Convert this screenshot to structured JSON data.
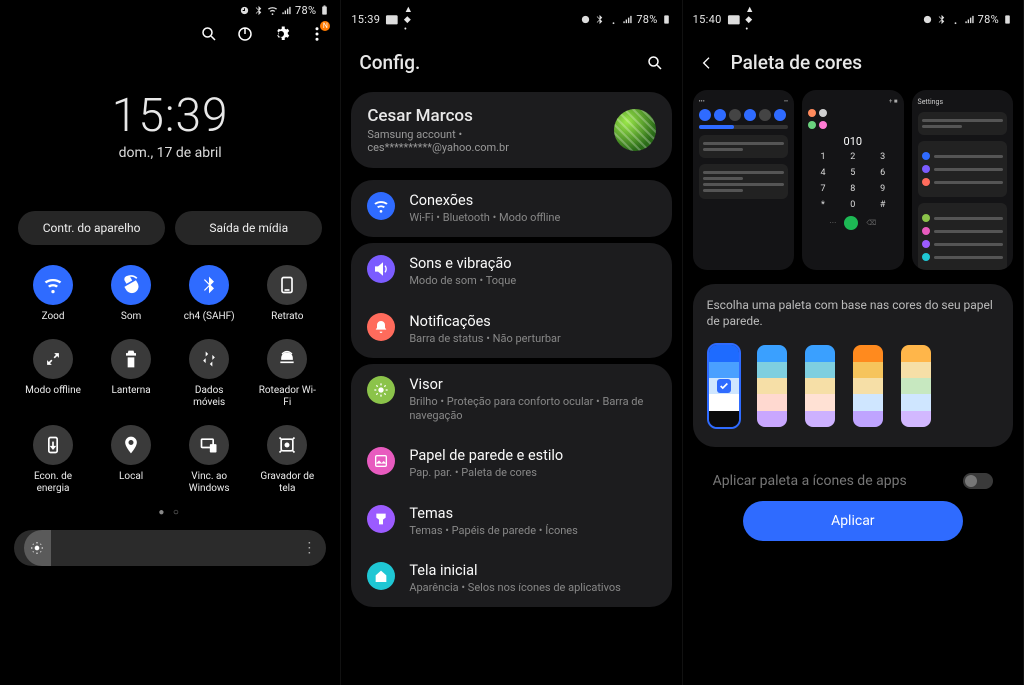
{
  "status": {
    "time_a": "15:39",
    "time_b": "15:39",
    "time_c": "15:40",
    "battery": "78%"
  },
  "qs": {
    "time": "15:39",
    "date": "dom., 17 de abril",
    "device_controls": "Contr. do aparelho",
    "media_output": "Saída de mídia",
    "tiles": [
      {
        "label": "Zood",
        "on": true
      },
      {
        "label": "Som",
        "on": true
      },
      {
        "label": "ch4 (SAHF)",
        "on": true
      },
      {
        "label": "Retrato",
        "on": false
      },
      {
        "label": "Modo offline",
        "on": false
      },
      {
        "label": "Lanterna",
        "on": false
      },
      {
        "label": "Dados móveis",
        "on": false
      },
      {
        "label": "Roteador Wi-Fi",
        "on": false
      },
      {
        "label": "Econ. de energia",
        "on": false
      },
      {
        "label": "Local",
        "on": false
      },
      {
        "label": "Vinc. ao Windows",
        "on": false
      },
      {
        "label": "Gravador de tela",
        "on": false
      }
    ],
    "page_dots": "● ○",
    "badge": "N"
  },
  "settings": {
    "title": "Config.",
    "account": {
      "name": "Cesar Marcos",
      "sub": "Samsung account  •  ces**********@yahoo.com.br"
    },
    "groups": [
      [
        {
          "color": "#2f6bff",
          "title": "Conexões",
          "sub": "Wi-Fi  •  Bluetooth  •  Modo offline"
        }
      ],
      [
        {
          "color": "#7b5cff",
          "title": "Sons e vibração",
          "sub": "Modo de som  •  Toque"
        },
        {
          "color": "#ff6b5c",
          "title": "Notificações",
          "sub": "Barra de status  •  Não perturbar"
        }
      ],
      [
        {
          "color": "#8bc34a",
          "title": "Visor",
          "sub": "Brilho  •  Proteção para conforto ocular  •  Barra de navegação"
        },
        {
          "color": "#e85bbf",
          "title": "Papel de parede e estilo",
          "sub": "Pap. par.  •  Paleta de cores"
        },
        {
          "color": "#9b5bff",
          "title": "Temas",
          "sub": "Temas  •  Papéis de parede  •  Ícones"
        },
        {
          "color": "#1fc7d4",
          "title": "Tela inicial",
          "sub": "Aparência  •  Selos nos ícones de aplicativos"
        }
      ]
    ]
  },
  "palette": {
    "title": "Paleta de cores",
    "preview_dial": "010",
    "preview_settings_hdr": "Settings",
    "keypad": [
      "1",
      "2",
      "3",
      "4",
      "5",
      "6",
      "7",
      "8",
      "9",
      "*",
      "0",
      "#"
    ],
    "desc": "Escolha uma paleta com base nas cores do seu papel de parede.",
    "swatches": [
      {
        "selected": true,
        "colors": [
          "#1e6bff",
          "#4aa0ff",
          "#cfe6ff",
          "#ffffff",
          "#0b0b0b"
        ]
      },
      {
        "selected": false,
        "colors": [
          "#3aa0ff",
          "#7fcfe0",
          "#f6dfa7",
          "#ffd9d0",
          "#c9a7ff"
        ]
      },
      {
        "selected": false,
        "colors": [
          "#3aa0ff",
          "#7fcfe0",
          "#f6dfa7",
          "#ffe1d4",
          "#cdb1ff"
        ]
      },
      {
        "selected": false,
        "colors": [
          "#ff8a1e",
          "#f6c45c",
          "#f6dfa7",
          "#cfe6ff",
          "#bfa4ff"
        ]
      },
      {
        "selected": false,
        "colors": [
          "#ffb64a",
          "#f6dfa7",
          "#c7e8c0",
          "#cfe6ff",
          "#d2b8ff"
        ]
      }
    ],
    "apply_icons_label": "Aplicar paleta a ícones de apps",
    "apply_btn": "Aplicar"
  }
}
